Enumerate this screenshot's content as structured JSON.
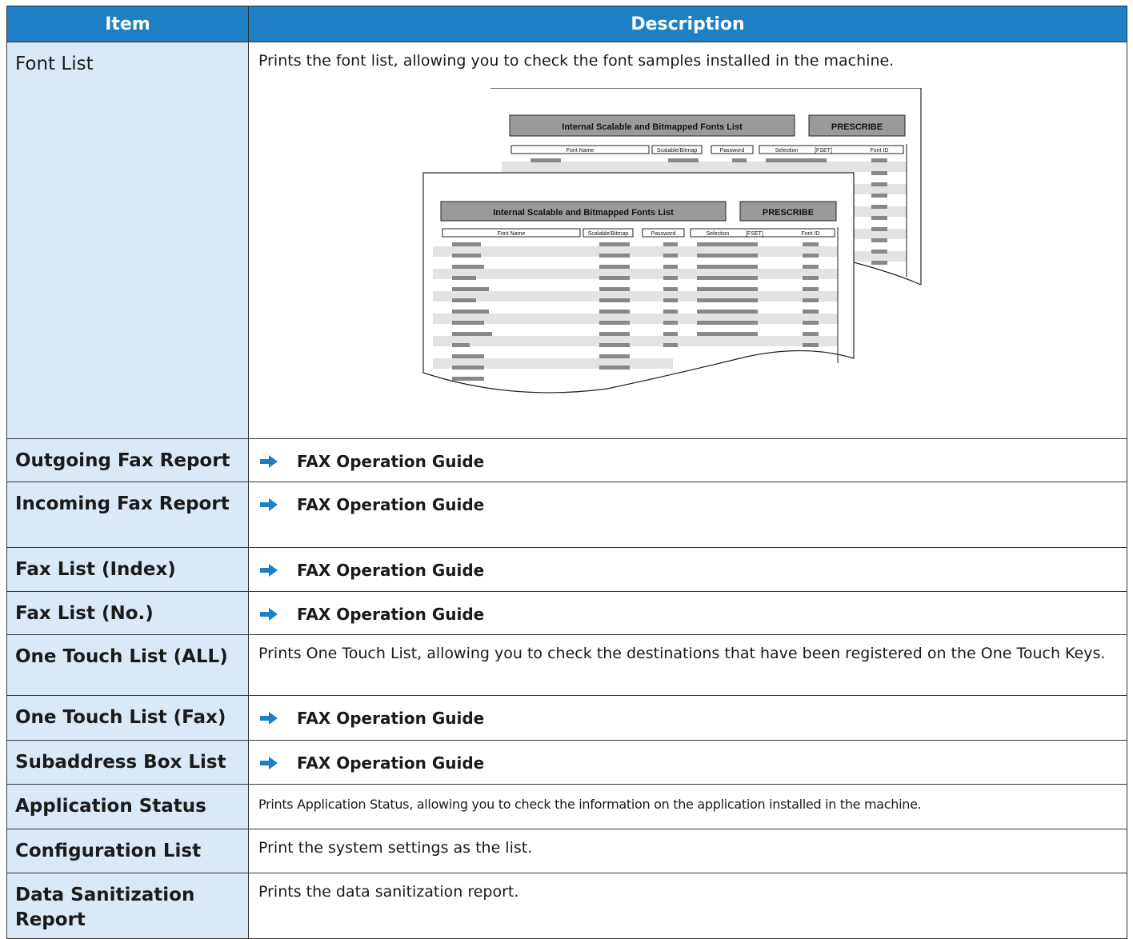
{
  "header": {
    "item": "Item",
    "description": "Description"
  },
  "rows": [
    {
      "item": "Font List",
      "description": "Prints the font list, allowing you to check the font samples installed in the machine."
    },
    {
      "item": "Outgoing Fax Report",
      "link": "FAX Operation Guide"
    },
    {
      "item": "Incoming Fax Report",
      "link": "FAX Operation Guide"
    },
    {
      "item": "Fax List (Index)",
      "link": "FAX Operation Guide"
    },
    {
      "item": "Fax List (No.)",
      "link": "FAX Operation Guide"
    },
    {
      "item": "One Touch List (ALL)",
      "description": "Prints One Touch List, allowing you to check the destinations that have been registered on the One Touch Keys."
    },
    {
      "item": "One Touch List (Fax)",
      "link": "FAX Operation Guide"
    },
    {
      "item": "Subaddress Box List",
      "link": "FAX Operation Guide"
    },
    {
      "item": "Application Status",
      "description": "Prints Application Status, allowing you to check the information on the application installed in the machine."
    },
    {
      "item": "Configuration List",
      "description": "Print the system settings as the list."
    },
    {
      "item": "Data Sanitization Report",
      "description": "Prints the data sanitization report."
    }
  ],
  "illustration": {
    "banner_title": "Internal Scalable and Bitmapped Fonts List",
    "banner_tag": "PRESCRIBE",
    "columns": [
      "Font Name",
      "Scalable/Bitmap",
      "Password",
      "Selection",
      "[FSET]",
      "Font ID"
    ]
  },
  "colors": {
    "header_bg": "#1d7fc4",
    "item_bg": "#dbe9f7",
    "arrow": "#1d7fc4"
  }
}
